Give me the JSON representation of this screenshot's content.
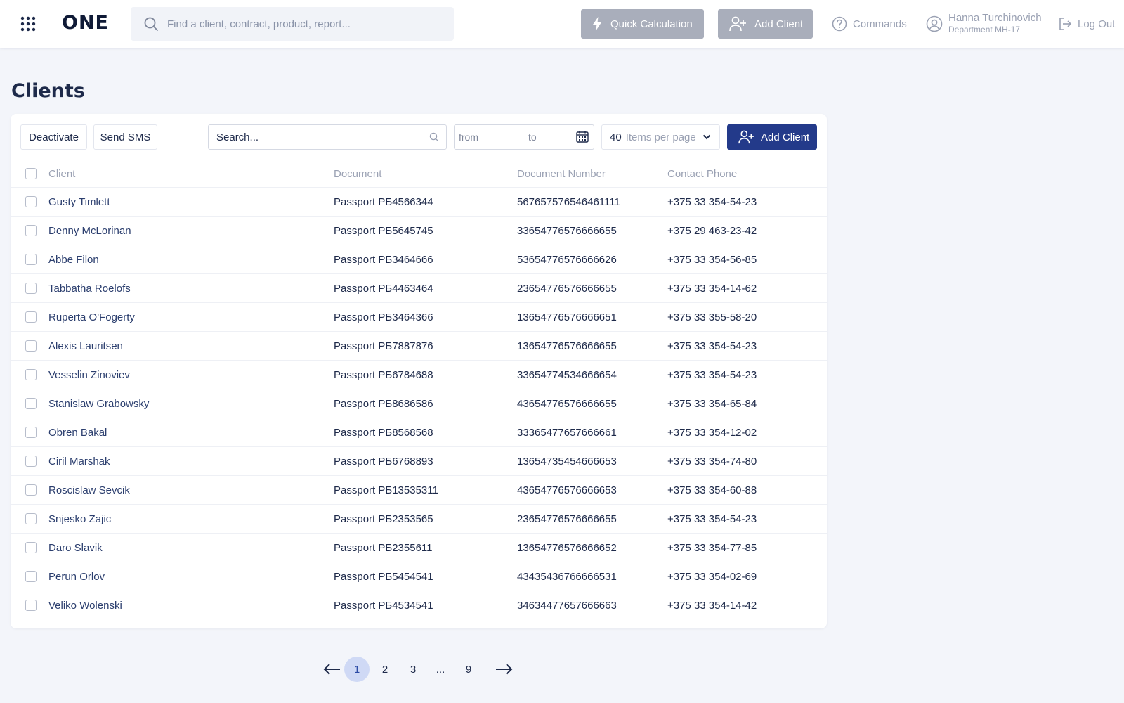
{
  "app": {
    "logo": "ONE"
  },
  "header": {
    "search_placeholder": "Find a client, contract, product, report...",
    "quick_calculation": "Quick Calculation",
    "add_client": "Add Client",
    "commands": "Commands",
    "user_name": "Hanna Turchinovich",
    "user_department": "Department MH-17",
    "logout": "Log Out"
  },
  "page": {
    "title": "Clients"
  },
  "toolbar": {
    "deactivate": "Deactivate",
    "send_sms": "Send SMS",
    "search_placeholder": "Search...",
    "date_from": "from",
    "date_to": "to",
    "per_page_value": "40",
    "per_page_label": "Items per page",
    "add_client": "Add Client"
  },
  "table": {
    "columns": [
      "Client",
      "Document",
      "Document Number",
      "Contact Phone"
    ],
    "rows": [
      {
        "client": "Gusty Timlett",
        "document": "Passport PБ4566344",
        "number": "567657576546461111",
        "phone": "+375 33 354-54-23"
      },
      {
        "client": "Denny McLorinan",
        "document": "Passport PБ5645745",
        "number": "33654776576666655",
        "phone": "+375 29 463-23-42"
      },
      {
        "client": "Abbe Filon",
        "document": "Passport PБ3464666",
        "number": "53654776576666626",
        "phone": "+375 33 354-56-85"
      },
      {
        "client": "Tabbatha Roelofs",
        "document": "Passport PБ4463464",
        "number": "23654776576666655",
        "phone": "+375 33 354-14-62"
      },
      {
        "client": "Ruperta O'Fogerty",
        "document": "Passport PБ3464366",
        "number": "13654776576666651",
        "phone": "+375 33 355-58-20"
      },
      {
        "client": "Alexis Lauritsen",
        "document": "Passport PБ7887876",
        "number": "13654776576666655",
        "phone": "+375 33 354-54-23"
      },
      {
        "client": "Vesselin Zinoviev",
        "document": "Passport PБ6784688",
        "number": "33654774534666654",
        "phone": "+375 33 354-54-23"
      },
      {
        "client": "Stanislaw Grabowsky",
        "document": "Passport PБ8686586",
        "number": "43654776576666655",
        "phone": "+375 33 354-65-84"
      },
      {
        "client": "Obren Bakal",
        "document": "Passport PБ8568568",
        "number": "33365477657666661",
        "phone": "+375 33 354-12-02"
      },
      {
        "client": "Ciril Marshak",
        "document": "Passport PБ6768893",
        "number": "13654735454666653",
        "phone": "+375 33 354-74-80"
      },
      {
        "client": "Roscislaw Sevcik",
        "document": "Passport PБ13535311",
        "number": "43654776576666653",
        "phone": "+375 33 354-60-88"
      },
      {
        "client": "Snjesko Zajic",
        "document": "Passport PБ2353565",
        "number": "23654776576666655",
        "phone": "+375 33 354-54-23"
      },
      {
        "client": "Daro Slavik",
        "document": "Passport PБ2355611",
        "number": "13654776576666652",
        "phone": "+375 33 354-77-85"
      },
      {
        "client": "Perun Orlov",
        "document": "Passport PБ5454541",
        "number": "43435436766666531",
        "phone": "+375 33 354-02-69"
      },
      {
        "client": "Veliko Wolenski",
        "document": "Passport PБ4534541",
        "number": "34634477657666663",
        "phone": "+375 33 354-14-42"
      }
    ]
  },
  "pagination": {
    "pages": [
      "1",
      "2",
      "3",
      "...",
      "9"
    ],
    "current": "1"
  },
  "colors": {
    "primary": "#233a8a",
    "disabled_button": "#a9aebb",
    "muted_text": "#9aa1b3",
    "page_background": "#f3f5fa",
    "active_page": "#cfd9f5"
  },
  "icons": [
    "apps-grid-icon",
    "search-icon",
    "lightning-icon",
    "add-user-icon",
    "help-circle-icon",
    "user-circle-icon",
    "logout-icon",
    "calendar-icon",
    "chevron-down-icon",
    "arrow-left-icon",
    "arrow-right-icon"
  ]
}
